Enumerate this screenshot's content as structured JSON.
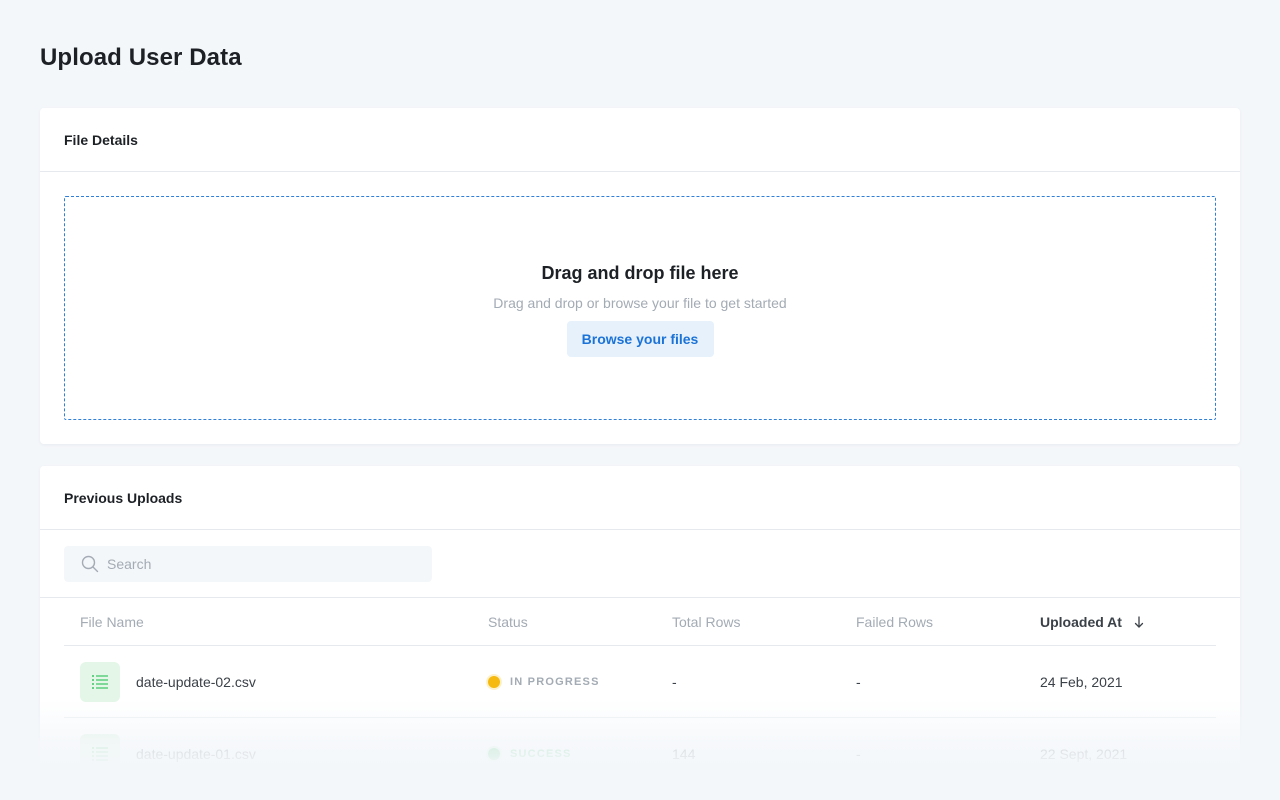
{
  "page": {
    "title": "Upload User Data"
  },
  "file_details": {
    "title": "File Details",
    "dropzone": {
      "heading": "Drag and drop file here",
      "subtext": "Drag and drop or browse your file to get started",
      "browse_label": "Browse your files"
    }
  },
  "previous_uploads": {
    "title": "Previous Uploads",
    "search": {
      "placeholder": "Search",
      "value": ""
    },
    "columns": {
      "file_name": "File Name",
      "status": "Status",
      "total_rows": "Total Rows",
      "failed_rows": "Failed Rows",
      "uploaded_at": "Uploaded At"
    },
    "sort": {
      "column": "uploaded_at",
      "direction": "descending",
      "icon": "arrow-down-icon"
    },
    "rows": [
      {
        "file_name": "date-update-02.csv",
        "status": "IN PROGRESS",
        "status_color": "#f5b90f",
        "total_rows": "-",
        "failed_rows": "-",
        "uploaded_at": "24 Feb, 2021",
        "icon": "list-file-icon"
      },
      {
        "file_name": "date-update-01.csv",
        "status": "SUCCESS",
        "status_color": "#3bc463",
        "total_rows": "144",
        "failed_rows": "-",
        "uploaded_at": "22 Sept, 2021",
        "icon": "list-file-icon"
      }
    ]
  },
  "colors": {
    "background": "#f4f7fa",
    "accent": "#1b73d8",
    "file_icon_bg": "#e3f6e7",
    "file_icon_fg": "#3bc463"
  }
}
